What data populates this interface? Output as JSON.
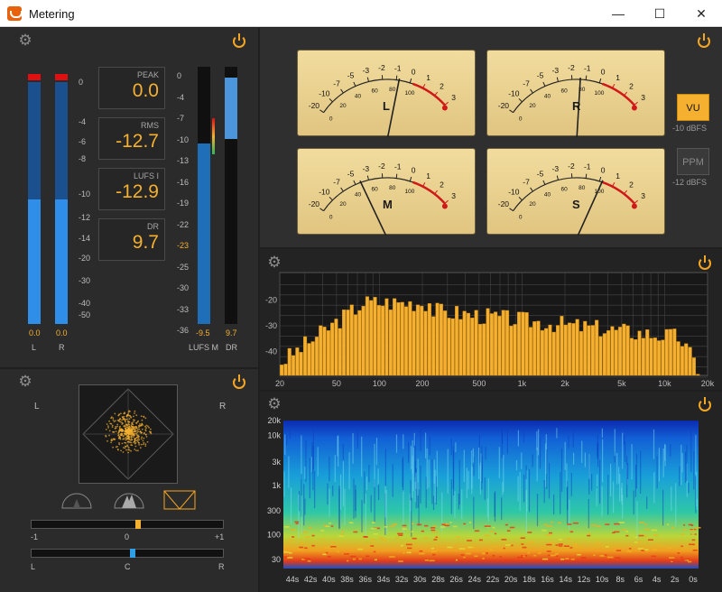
{
  "window": {
    "title": "Metering",
    "minimize": "—",
    "maximize": "☐",
    "close": "✕"
  },
  "colors": {
    "accent": "#f5b030",
    "meter_blue": "#2f8fe8",
    "clip_red": "#e01010"
  },
  "icons": {
    "settings": "gear-icon",
    "power": "power-icon"
  },
  "level_meter": {
    "scale": [
      "0",
      "-4",
      "-6",
      "-8",
      "-10",
      "-12",
      "-14",
      "-20",
      "-30",
      "-40",
      "-50"
    ],
    "channels": [
      {
        "label": "L",
        "peak_text": "0.0",
        "level_fraction": 0.6
      },
      {
        "label": "R",
        "peak_text": "0.0",
        "level_fraction": 0.6
      }
    ]
  },
  "readouts": [
    {
      "caption": "PEAK",
      "value": "0.0"
    },
    {
      "caption": "RMS",
      "value": "-12.7"
    },
    {
      "caption": "LUFS I",
      "value": "-12.9"
    },
    {
      "caption": "DR",
      "value": "9.7"
    }
  ],
  "loudness": {
    "scale": [
      "0",
      "-4",
      "-7",
      "-10",
      "-13",
      "-16",
      "-19",
      "-22",
      "-23",
      "-25",
      "-30",
      "-33",
      "-36"
    ],
    "target_marker": "-23",
    "lufs_m": {
      "label": "LUFS M",
      "value": "-9.5",
      "level_fraction": 0.7
    },
    "dr": {
      "label": "DR",
      "value": "9.7",
      "level_fraction": 0.75
    }
  },
  "vu_meters": {
    "scale": [
      "-20",
      "-10",
      "-7",
      "-5",
      "-3",
      "-2",
      "-1",
      "0",
      "1",
      "2",
      "3"
    ],
    "percent_scale": [
      "0",
      "20",
      "40",
      "60",
      "80",
      "100"
    ],
    "meters": [
      {
        "channel": "L",
        "needle_value": 0.62
      },
      {
        "channel": "R",
        "needle_value": 0.56
      },
      {
        "channel": "M",
        "needle_value": 0.34
      },
      {
        "channel": "S",
        "needle_value": 0.72
      }
    ],
    "modes": [
      {
        "label": "VU",
        "sub": "-10 dBFS",
        "active": true
      },
      {
        "label": "PPM",
        "sub": "-12 dBFS",
        "active": false
      }
    ]
  },
  "spectrum": {
    "y_labels": [
      "-20",
      "-30",
      "-40"
    ],
    "x_labels": [
      "20",
      "50",
      "100",
      "200",
      "500",
      "1k",
      "2k",
      "5k",
      "10k",
      "20k"
    ]
  },
  "goniometer": {
    "left_label": "L",
    "right_label": "R",
    "correlation": {
      "min": "-1",
      "mid": "0",
      "max": "+1",
      "value": 0.1
    },
    "balance": {
      "left": "L",
      "mid": "C",
      "right": "R",
      "value": 0.05
    }
  },
  "spectrogram": {
    "y_labels": [
      "20k",
      "10k",
      "3k",
      "1k",
      "300",
      "100",
      "30"
    ],
    "x_labels": [
      "44s",
      "42s",
      "40s",
      "38s",
      "36s",
      "34s",
      "32s",
      "30s",
      "28s",
      "26s",
      "24s",
      "22s",
      "20s",
      "18s",
      "16s",
      "14s",
      "12s",
      "10s",
      "8s",
      "6s",
      "4s",
      "2s",
      "0s"
    ]
  }
}
